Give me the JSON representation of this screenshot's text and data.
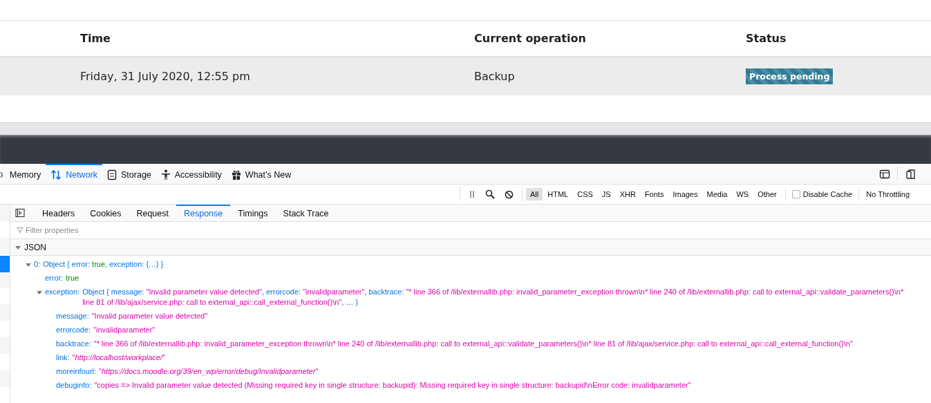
{
  "page": {
    "table": {
      "columns": [
        "Time",
        "Current operation",
        "Status"
      ],
      "rows": [
        {
          "time": "Friday, 31 July 2020, 12:55 pm",
          "operation": "Backup",
          "status": {
            "label": "Process pending",
            "kind": "pending"
          }
        }
      ]
    }
  },
  "devtools": {
    "tools": [
      {
        "label": "Memory",
        "kind": "memory",
        "selected": false
      },
      {
        "label": "Network",
        "kind": "network",
        "selected": true
      },
      {
        "label": "Storage",
        "kind": "storage",
        "selected": false
      },
      {
        "label": "Accessibility",
        "kind": "accessibility",
        "selected": false
      },
      {
        "label": "What’s New",
        "kind": "whatsnew",
        "selected": false
      }
    ],
    "filters": [
      {
        "label": "All",
        "selected": true
      },
      {
        "label": "HTML",
        "selected": false
      },
      {
        "label": "CSS",
        "selected": false
      },
      {
        "label": "JS",
        "selected": false
      },
      {
        "label": "XHR",
        "selected": false
      },
      {
        "label": "Fonts",
        "selected": false
      },
      {
        "label": "Images",
        "selected": false
      },
      {
        "label": "Media",
        "selected": false
      },
      {
        "label": "WS",
        "selected": false
      },
      {
        "label": "Other",
        "selected": false
      }
    ],
    "disable_cache": {
      "label": "Disable Cache",
      "checked": false
    },
    "throttling": "No Throttling",
    "detail_tabs": [
      {
        "label": "Headers",
        "selected": false
      },
      {
        "label": "Cookies",
        "selected": false
      },
      {
        "label": "Request",
        "selected": false
      },
      {
        "label": "Response",
        "selected": true
      },
      {
        "label": "Timings",
        "selected": false
      },
      {
        "label": "Stack Trace",
        "selected": false
      }
    ],
    "filter_placeholder": "Filter properties",
    "json_section": {
      "label": "JSON",
      "expanded": true
    },
    "tree": [
      {
        "key": "0:",
        "expanded": true,
        "value": [
          {
            "kind": "text",
            "text": "Object { error: "
          },
          {
            "kind": "bool",
            "text": "true"
          },
          {
            "kind": "text",
            "text": ", exception: {…} }"
          }
        ],
        "children": [
          {
            "key": "error:",
            "value": [
              {
                "kind": "bool",
                "text": "true"
              }
            ]
          },
          {
            "key": "exception:",
            "expanded": true,
            "value": [
              {
                "kind": "text",
                "text": "Object { message: "
              },
              {
                "kind": "string",
                "text": "\"Invalid parameter value detected\""
              },
              {
                "kind": "text",
                "text": ", errorcode: "
              },
              {
                "kind": "string",
                "text": "\"invalidparameter\""
              },
              {
                "kind": "text",
                "text": ", backtrace: "
              },
              {
                "kind": "string",
                "text": "\"* line 366 of /lib/externallib.php: invalid_parameter_exception thrown\\n* line 240 of /lib/externallib.php: call to external_api::validate_parameters()\\n* line 81 of /lib/ajax/service.php: call to external_api::call_external_function()\\n\""
              },
              {
                "kind": "text",
                "text": ", "
              },
              {
                "kind": "ellipsis",
                "text": "…"
              },
              {
                "kind": "text",
                "text": " }"
              }
            ],
            "children": [
              {
                "key": "message:",
                "value": [
                  {
                    "kind": "string",
                    "text": "\"Invalid parameter value detected\""
                  }
                ]
              },
              {
                "key": "errorcode:",
                "value": [
                  {
                    "kind": "string",
                    "text": "\"invalidparameter\""
                  }
                ]
              },
              {
                "key": "backtrace:",
                "value": [
                  {
                    "kind": "string",
                    "text": "\"* line 366 of /lib/externallib.php: invalid_parameter_exception thrown\\n* line 240 of /lib/externallib.php: call to external_api::validate_parameters()\\n* line 81 of /lib/ajax/service.php: call to external_api::call_external_function()\\n\""
                  }
                ]
              },
              {
                "key": "link:",
                "value": [
                  {
                    "kind": "string",
                    "text": "\""
                  },
                  {
                    "kind": "url",
                    "text": "http://localhost/workplace/"
                  },
                  {
                    "kind": "string",
                    "text": "\""
                  }
                ]
              },
              {
                "key": "moreinfourl:",
                "value": [
                  {
                    "kind": "string",
                    "text": "\""
                  },
                  {
                    "kind": "url",
                    "text": "https://docs.moodle.org/39/en_wp/error/debug/invalidparameter"
                  },
                  {
                    "kind": "string",
                    "text": "\""
                  }
                ]
              },
              {
                "key": "debuginfo:",
                "value": [
                  {
                    "kind": "string",
                    "text": "\"copies => Invalid parameter value detected (Missing required key in single structure: backupid): Missing required key in single structure: backupid\\nError code: invalidparameter\""
                  }
                ]
              }
            ]
          }
        ]
      }
    ]
  }
}
